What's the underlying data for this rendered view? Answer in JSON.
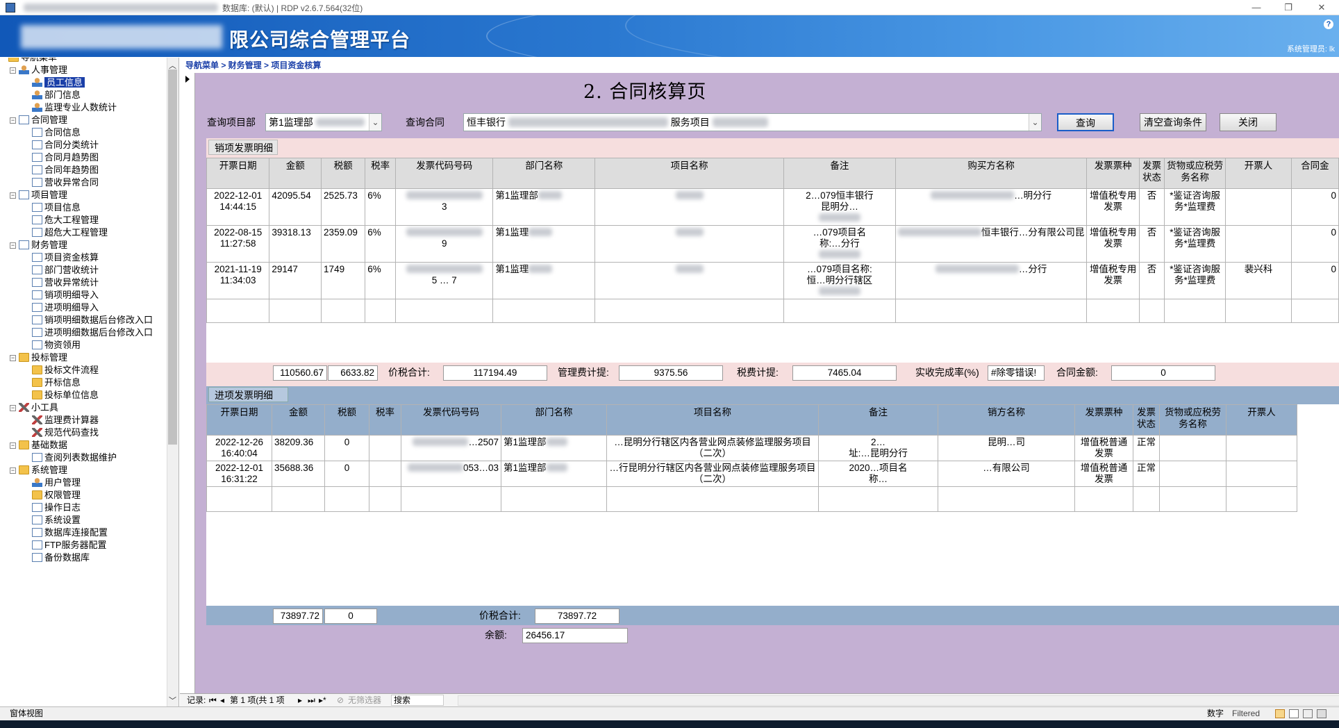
{
  "window": {
    "title": "数据库: (默认) | RDP v2.6.7.564(32位)",
    "minimize": "—",
    "restore": "❐",
    "close": "✕"
  },
  "banner": {
    "title": "限公司综合管理平台",
    "help": "?",
    "user": "系统管理员: lk"
  },
  "sidebar": {
    "root": "导航菜单",
    "items": [
      {
        "label": "人事管理",
        "level": 1,
        "icon": "people-icon"
      },
      {
        "label": "员工信息",
        "level": 2,
        "icon": "person-icon",
        "selected": true
      },
      {
        "label": "部门信息",
        "level": 2,
        "icon": "person-icon"
      },
      {
        "label": "监理专业人数统计",
        "level": 2,
        "icon": "person-icon"
      },
      {
        "label": "合同管理",
        "level": 1,
        "icon": "page-icon"
      },
      {
        "label": "合同信息",
        "level": 2,
        "icon": "page-icon"
      },
      {
        "label": "合同分类统计",
        "level": 2,
        "icon": "page-icon"
      },
      {
        "label": "合同月趋势图",
        "level": 2,
        "icon": "page-icon"
      },
      {
        "label": "合同年趋势图",
        "level": 2,
        "icon": "page-icon"
      },
      {
        "label": "营收异常合同",
        "level": 2,
        "icon": "page-icon"
      },
      {
        "label": "项目管理",
        "level": 1,
        "icon": "page-icon"
      },
      {
        "label": "项目信息",
        "level": 2,
        "icon": "page-icon"
      },
      {
        "label": "危大工程管理",
        "level": 2,
        "icon": "page-icon"
      },
      {
        "label": "超危大工程管理",
        "level": 2,
        "icon": "page-icon"
      },
      {
        "label": "财务管理",
        "level": 1,
        "icon": "page-icon"
      },
      {
        "label": "项目资金核算",
        "level": 2,
        "icon": "page-icon"
      },
      {
        "label": "部门营收统计",
        "level": 2,
        "icon": "page-icon"
      },
      {
        "label": "营收异常统计",
        "level": 2,
        "icon": "page-icon"
      },
      {
        "label": "销项明细导入",
        "level": 2,
        "icon": "page-icon"
      },
      {
        "label": "进项明细导入",
        "level": 2,
        "icon": "page-icon"
      },
      {
        "label": "销项明细数据后台修改入口",
        "level": 2,
        "icon": "page-icon"
      },
      {
        "label": "进项明细数据后台修改入口",
        "level": 2,
        "icon": "page-icon"
      },
      {
        "label": "物资领用",
        "level": 2,
        "icon": "page-icon"
      },
      {
        "label": "投标管理",
        "level": 1,
        "icon": "key-icon"
      },
      {
        "label": "投标文件流程",
        "level": 2,
        "icon": "key-icon"
      },
      {
        "label": "开标信息",
        "level": 2,
        "icon": "key-icon"
      },
      {
        "label": "投标单位信息",
        "level": 2,
        "icon": "key-icon"
      },
      {
        "label": "小工具",
        "level": 1,
        "icon": "tool-icon"
      },
      {
        "label": "监理费计算器",
        "level": 2,
        "icon": "tool-icon"
      },
      {
        "label": "规范代码查找",
        "level": 2,
        "icon": "tool-icon"
      },
      {
        "label": "基础数据",
        "level": 1,
        "icon": "folder-icon"
      },
      {
        "label": "查阅列表数据维护",
        "level": 2,
        "icon": "page-icon"
      },
      {
        "label": "系统管理",
        "level": 1,
        "icon": "folder-icon"
      },
      {
        "label": "用户管理",
        "level": 2,
        "icon": "people-icon"
      },
      {
        "label": "权限管理",
        "level": 2,
        "icon": "lock-icon"
      },
      {
        "label": "操作日志",
        "level": 2,
        "icon": "page-icon"
      },
      {
        "label": "系统设置",
        "level": 2,
        "icon": "page-icon"
      },
      {
        "label": "数据库连接配置",
        "level": 2,
        "icon": "page-icon"
      },
      {
        "label": "FTP服务器配置",
        "level": 2,
        "icon": "page-icon"
      },
      {
        "label": "备份数据库",
        "level": 2,
        "icon": "page-icon"
      }
    ]
  },
  "breadcrumb": "导航菜单 > 财务管理 > 项目资金核算",
  "page_title": "2. 合同核算页",
  "query": {
    "dept_label": "查询项目部",
    "dept_value": "第1监理部",
    "contract_label": "查询合同",
    "contract_value": "恒丰银行",
    "contract_value_tail": "服务项目",
    "search_btn": "查询",
    "clear_btn": "清空查询条件",
    "close_btn": "关闭"
  },
  "sales": {
    "section_title": "销项发票明细",
    "columns": [
      "开票日期",
      "金额",
      "税额",
      "税率",
      "发票代码号码",
      "部门名称",
      "项目名称",
      "备注",
      "购买方名称",
      "发票票种",
      "发票状态",
      "货物或应税劳务名称",
      "开票人",
      "合同金"
    ],
    "rows": [
      {
        "date": "2022-12-01",
        "time": "14:44:15",
        "amount": "42095.54",
        "tax": "2525.73",
        "rate": "6%",
        "code": "3",
        "dept": "第1监理部",
        "project": "",
        "remark": "2…079恒丰银行",
        "remark2": "昆明分…",
        "buyer": "…明分行",
        "type": "增值税专用发票",
        "status": "否",
        "goods": "*鉴证咨询服务*监理费",
        "drawer": "",
        "contract": "0"
      },
      {
        "date": "2022-08-15",
        "time": "11:27:58",
        "amount": "39318.13",
        "tax": "2359.09",
        "rate": "6%",
        "code": "9",
        "dept": "第1监理",
        "project": "",
        "remark": "…079项目名",
        "remark2": "称:…分行",
        "buyer": "恒丰银行…分有限公司昆",
        "type": "增值税专用发票",
        "status": "否",
        "goods": "*鉴证咨询服务*监理费",
        "drawer": "",
        "contract": "0"
      },
      {
        "date": "2021-11-19",
        "time": "11:34:03",
        "amount": "29147",
        "tax": "1749",
        "rate": "6%",
        "code": "5 … 7",
        "dept": "第1监理",
        "project": "",
        "remark": "…079项目名称:",
        "remark2": "恒…明分行辖区",
        "buyer": "…分行",
        "type": "增值税专用发票",
        "status": "否",
        "goods": "*鉴证咨询服务*监理费",
        "drawer": "裴兴科",
        "contract": "0"
      }
    ],
    "totals": {
      "amount": "110560.67",
      "tax": "6633.82",
      "price_tax_label": "价税合计:",
      "price_tax": "117194.49",
      "mgmt_label": "管理费计提:",
      "mgmt": "9375.56",
      "taxcalc_label": "税费计提:",
      "taxcalc": "7465.04",
      "rate_label": "实收完成率(%)",
      "rate": "#除零错误!",
      "contract_label": "合同金额:",
      "contract": "0"
    }
  },
  "purchase": {
    "section_title": "进项发票明细",
    "columns": [
      "开票日期",
      "金额",
      "税额",
      "税率",
      "发票代码号码",
      "部门名称",
      "项目名称",
      "备注",
      "销方名称",
      "发票票种",
      "发票状态",
      "货物或应税劳务名称",
      "开票人"
    ],
    "rows": [
      {
        "date": "2022-12-26",
        "time": "16:40:04",
        "amount": "38209.36",
        "tax": "0",
        "rate": "",
        "code": "…2507",
        "dept": "第1监理部",
        "project": "…昆明分行辖区内各营业网点装修监理服务项目（二次）",
        "remark": "2…",
        "remark2": "址:…昆明分行",
        "seller": "昆明…司",
        "type": "增值税普通发票",
        "status": "正常",
        "goods": "",
        "drawer": ""
      },
      {
        "date": "2022-12-01",
        "time": "16:31:22",
        "amount": "35688.36",
        "tax": "0",
        "rate": "",
        "code": "053…03",
        "dept": "第1监理部",
        "project": "…行昆明分行辖区内各营业网点装修监理服务项目（二次）",
        "remark": "2020…项目名",
        "remark2": "称…",
        "seller": "…有限公司",
        "type": "增值税普通发票",
        "status": "正常",
        "goods": "",
        "drawer": ""
      }
    ],
    "totals": {
      "amount": "73897.72",
      "tax": "0",
      "price_tax_label": "价税合计:",
      "price_tax": "73897.72",
      "balance_label": "余额:",
      "balance": "26456.17"
    }
  },
  "navbar": {
    "record_label": "记录:",
    "record_pos": "第 1 项(共 1 项",
    "filter": "无筛选器",
    "search": "搜索"
  },
  "statusbar": {
    "left": "窗体视图",
    "num": "数字",
    "filtered": "Filtered"
  }
}
